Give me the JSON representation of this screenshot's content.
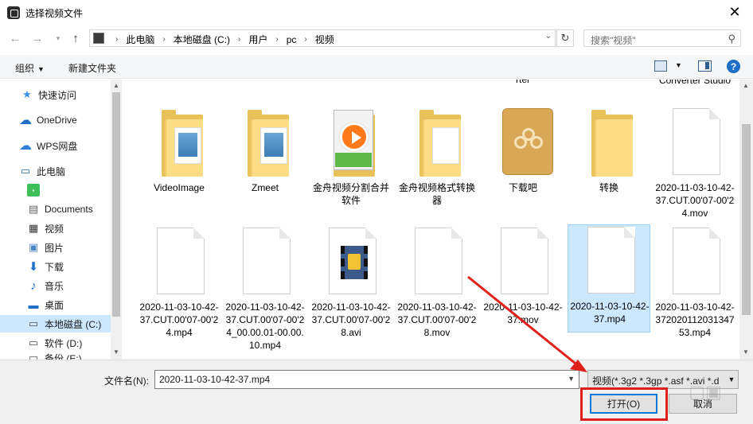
{
  "window": {
    "title": "选择视频文件"
  },
  "nav": {
    "breadcrumbs": [
      "此电脑",
      "本地磁盘 (C:)",
      "用户",
      "pc",
      "视频"
    ],
    "search_placeholder": "搜索\"视频\""
  },
  "toolbar": {
    "organize_label": "组织",
    "new_folder_label": "新建文件夹"
  },
  "sidebar": {
    "items": [
      {
        "label": "快速访问",
        "icon": "star-icon"
      },
      {
        "label": "OneDrive",
        "icon": "cloud-icon"
      },
      {
        "label": "WPS网盘",
        "icon": "wps-cloud-icon"
      },
      {
        "label": "此电脑",
        "icon": "computer-icon"
      },
      {
        "label": "",
        "icon": "green-app-icon"
      },
      {
        "label": "Documents",
        "icon": "document-icon"
      },
      {
        "label": "视频",
        "icon": "video-icon"
      },
      {
        "label": "图片",
        "icon": "picture-icon"
      },
      {
        "label": "下载",
        "icon": "download-icon"
      },
      {
        "label": "音乐",
        "icon": "music-icon"
      },
      {
        "label": "桌面",
        "icon": "desktop-icon"
      },
      {
        "label": "本地磁盘 (C:)",
        "icon": "drive-icon",
        "selected": true
      },
      {
        "label": "软件 (D:)",
        "icon": "drive-icon"
      },
      {
        "label": "备份 (E:)",
        "icon": "drive-icon"
      }
    ]
  },
  "files": {
    "cut_top": [
      "rter",
      "Converter Studio"
    ],
    "items": [
      {
        "label": "VideoImage",
        "type": "folder-blue"
      },
      {
        "label": "Zmeet",
        "type": "folder-blue"
      },
      {
        "label": "金舟视频分割合并软件",
        "type": "folder-player"
      },
      {
        "label": "金舟视频格式转换器",
        "type": "folder"
      },
      {
        "label": "下载吧",
        "type": "baidu"
      },
      {
        "label": "转换",
        "type": "folder"
      },
      {
        "label": "2020-11-03-10-42-37.CUT.00'07-00'24.mov",
        "type": "doc"
      },
      {
        "label": "2020-11-03-10-42-37.CUT.00'07-00'24.mp4",
        "type": "doc"
      },
      {
        "label": "2020-11-03-10-42-37.CUT.00'07-00'24_00.00.01-00.00.10.mp4",
        "type": "doc"
      },
      {
        "label": "2020-11-03-10-42-37.CUT.00'07-00'28.avi",
        "type": "film"
      },
      {
        "label": "2020-11-03-10-42-37.CUT.00'07-00'28.mov",
        "type": "doc"
      },
      {
        "label": "2020-11-03-10-42-37.mov",
        "type": "doc"
      },
      {
        "label": "2020-11-03-10-42-37.mp4",
        "type": "doc",
        "selected": true
      },
      {
        "label": "2020-11-03-10-42-37202011203134753.mp4",
        "type": "doc"
      }
    ]
  },
  "footer": {
    "filename_label": "文件名(N):",
    "filename_value": "2020-11-03-10-42-37.mp4",
    "filetype_value": "视频(*.3g2 *.3gp *.asf *.avi *.d",
    "open_label": "打开(O)",
    "cancel_label": "取消"
  },
  "colors": {
    "selection": "#cce8ff",
    "accent": "#0078d7",
    "annotation": "#e0211b"
  }
}
